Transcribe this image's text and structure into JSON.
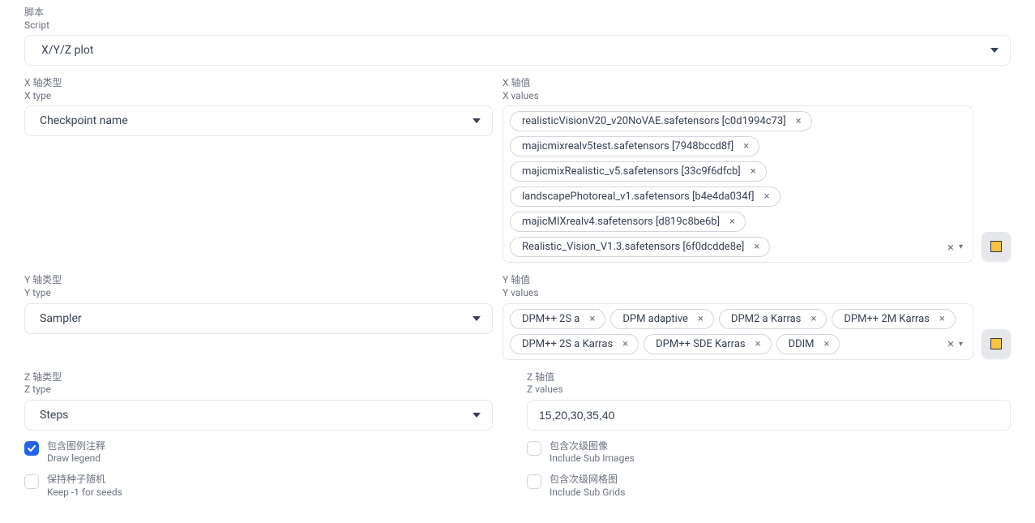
{
  "script": {
    "label_cn": "脚本",
    "label_en": "Script",
    "value": "X/Y/Z plot"
  },
  "x": {
    "type_label_cn": "X 轴类型",
    "type_label_en": "X type",
    "type_value": "Checkpoint name",
    "values_label_cn": "X 轴值",
    "values_label_en": "X values",
    "chips": [
      "realisticVisionV20_v20NoVAE.safetensors [c0d1994c73]",
      "majicmixrealv5test.safetensors [7948bccd8f]",
      "majicmixRealistic_v5.safetensors [33c9f6dfcb]",
      "landscapePhotoreal_v1.safetensors [b4e4da034f]",
      "majicMIXrealv4.safetensors [d819c8be6b]",
      "Realistic_Vision_V1.3.safetensors [6f0dcdde8e]"
    ]
  },
  "y": {
    "type_label_cn": "Y 轴类型",
    "type_label_en": "Y type",
    "type_value": "Sampler",
    "values_label_cn": "Y 轴值",
    "values_label_en": "Y values",
    "chips": [
      "DPM++ 2S a",
      "DPM adaptive",
      "DPM2 a Karras",
      "DPM++ 2M Karras",
      "DPM++ 2S a Karras",
      "DPM++ SDE Karras",
      "DDIM"
    ]
  },
  "z": {
    "type_label_cn": "Z 轴类型",
    "type_label_en": "Z type",
    "type_value": "Steps",
    "values_label_cn": "Z 轴值",
    "values_label_en": "Z values",
    "value": "15,20,30,35,40"
  },
  "options": {
    "draw_legend_cn": "包含图例注释",
    "draw_legend_en": "Draw legend",
    "draw_legend_checked": true,
    "keep_seeds_cn": "保持种子随机",
    "keep_seeds_en": "Keep -1 for seeds",
    "keep_seeds_checked": false,
    "sub_images_cn": "包含次级图像",
    "sub_images_en": "Include Sub Images",
    "sub_images_checked": false,
    "sub_grids_cn": "包含次级网格图",
    "sub_grids_en": "Include Sub Grids",
    "sub_grids_checked": false
  }
}
